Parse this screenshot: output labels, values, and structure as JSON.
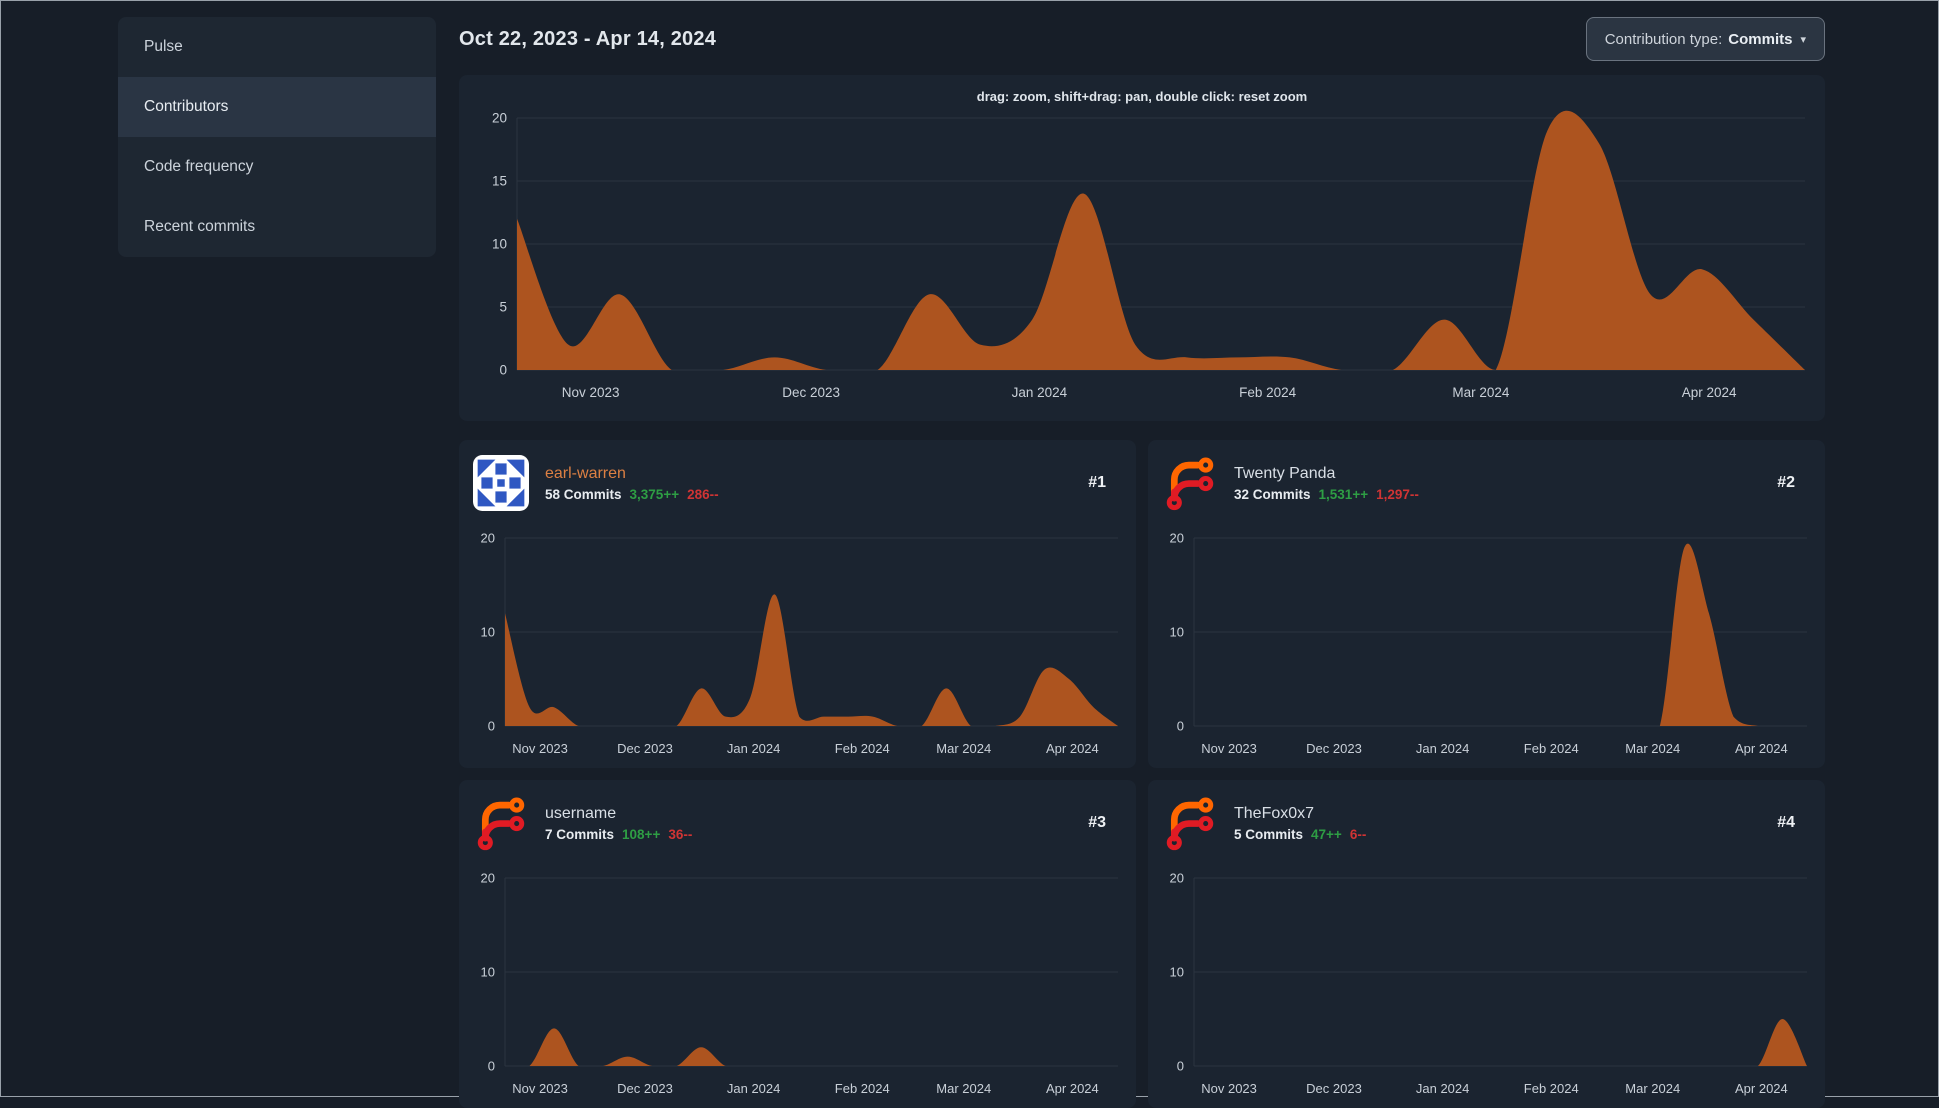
{
  "page": {
    "title_date_range": "Oct 22, 2023 - Apr 14, 2024"
  },
  "sidebar": {
    "items": [
      {
        "label": "Pulse",
        "active": false
      },
      {
        "label": "Contributors",
        "active": true
      },
      {
        "label": "Code frequency",
        "active": false
      },
      {
        "label": "Recent commits",
        "active": false
      }
    ]
  },
  "toolbar": {
    "contribution_type_label": "Contribution type:",
    "contribution_type_value": "Commits",
    "caret": "▾"
  },
  "main_chart_hint": "drag: zoom, shift+drag: pan, double click: reset zoom",
  "contributors": [
    {
      "rank": "#1",
      "name": "earl-warren",
      "commits": "58 Commits",
      "additions": "3,375++",
      "deletions": "286--",
      "avatar": "identicon-blue",
      "name_is_link": true
    },
    {
      "rank": "#2",
      "name": "Twenty Panda",
      "commits": "32 Commits",
      "additions": "1,531++",
      "deletions": "1,297--",
      "avatar": "forgejo-logo",
      "name_is_link": false
    },
    {
      "rank": "#3",
      "name": "username",
      "commits": "7 Commits",
      "additions": "108++",
      "deletions": "36--",
      "avatar": "forgejo-logo",
      "name_is_link": false
    },
    {
      "rank": "#4",
      "name": "TheFox0x7",
      "commits": "5 Commits",
      "additions": "47++",
      "deletions": "6--",
      "avatar": "forgejo-logo",
      "name_is_link": false
    }
  ],
  "chart_meta": {
    "weeks": [
      "Oct 22",
      "Oct 29",
      "Nov 5",
      "Nov 12",
      "Nov 19",
      "Nov 26",
      "Dec 3",
      "Dec 10",
      "Dec 17",
      "Dec 24",
      "Dec 31",
      "Jan 7",
      "Jan 14",
      "Jan 21",
      "Jan 28",
      "Feb 4",
      "Feb 11",
      "Feb 18",
      "Feb 25",
      "Mar 3",
      "Mar 10",
      "Mar 17",
      "Mar 24",
      "Mar 31",
      "Apr 7",
      "Apr 14"
    ],
    "xticks": [
      {
        "label": "Nov 2023",
        "i": 1.43
      },
      {
        "label": "Dec 2023",
        "i": 5.71
      },
      {
        "label": "Jan 2024",
        "i": 10.14
      },
      {
        "label": "Feb 2024",
        "i": 14.57
      },
      {
        "label": "Mar 2024",
        "i": 18.71
      },
      {
        "label": "Apr 2024",
        "i": 23.14
      }
    ],
    "ylim": [
      0,
      20
    ],
    "grid": true,
    "legend": "none"
  },
  "chart_data": [
    {
      "name": "all-contributions",
      "type": "area",
      "title": "drag: zoom, shift+drag: pan, double click: reset zoom",
      "yticks": [
        0,
        5,
        10,
        15,
        20
      ],
      "values": [
        12,
        2,
        6,
        0,
        0,
        1,
        0,
        0,
        6,
        2,
        4,
        14,
        2,
        1,
        1,
        1,
        0,
        0,
        4,
        0,
        19,
        18,
        6,
        8,
        4,
        0
      ]
    },
    {
      "name": "earl-warren",
      "type": "area",
      "yticks": [
        0,
        10,
        20
      ],
      "values": [
        12,
        2,
        2,
        0,
        0,
        0,
        0,
        0,
        4,
        1,
        3,
        14,
        1,
        1,
        1,
        1,
        0,
        0,
        4,
        0,
        0,
        1,
        6,
        5,
        2,
        0
      ]
    },
    {
      "name": "Twenty Panda",
      "type": "area",
      "yticks": [
        0,
        10,
        20
      ],
      "values": [
        0,
        0,
        0,
        0,
        0,
        0,
        0,
        0,
        0,
        0,
        0,
        0,
        0,
        0,
        0,
        0,
        0,
        0,
        0,
        0,
        19,
        12,
        1,
        0,
        0,
        0
      ]
    },
    {
      "name": "username",
      "type": "area",
      "yticks": [
        0,
        10,
        20
      ],
      "values": [
        0,
        0,
        4,
        0,
        0,
        1,
        0,
        0,
        2,
        0,
        0,
        0,
        0,
        0,
        0,
        0,
        0,
        0,
        0,
        0,
        0,
        0,
        0,
        0,
        0,
        0
      ]
    },
    {
      "name": "TheFox0x7",
      "type": "area",
      "yticks": [
        0,
        10,
        20
      ],
      "values": [
        0,
        0,
        0,
        0,
        0,
        0,
        0,
        0,
        0,
        0,
        0,
        0,
        0,
        0,
        0,
        0,
        0,
        0,
        0,
        0,
        0,
        0,
        0,
        0,
        5,
        0
      ]
    }
  ],
  "colors": {
    "page_bg": "#171e28",
    "panel_bg": "#1b2430",
    "sidebar_bg": "#1e2732",
    "sidebar_active_bg": "#2a3544",
    "area_fill": "#ad541f",
    "grid": "#2b3440",
    "axis_text": "#c9d0d8",
    "text": "#dbe1e8",
    "link_orange": "#dd8043",
    "additions_green": "#2e9e44",
    "deletions_red": "#d03434",
    "dropdown_bg": "#2b3542",
    "dropdown_border": "#6a737f",
    "identicon_blue": "#2f57c2",
    "logo_orange": "#ff6600",
    "logo_red": "#e01b24"
  }
}
